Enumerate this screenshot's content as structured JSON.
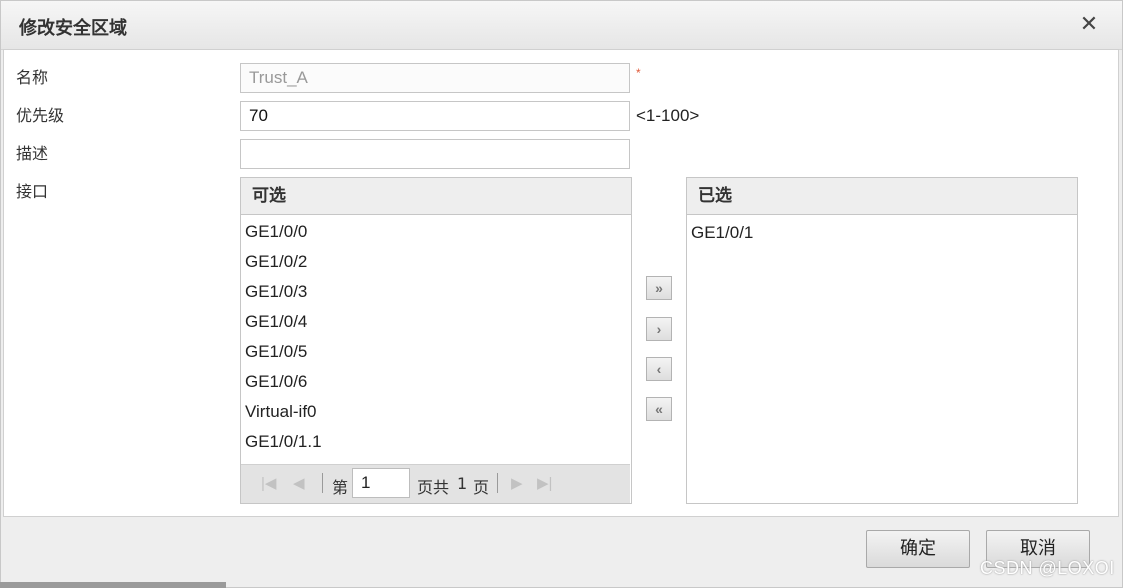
{
  "dialog": {
    "title": "修改安全区域",
    "close_glyph": "✕"
  },
  "form": {
    "name_label": "名称",
    "name_value": "Trust_A",
    "required_mark": "*",
    "priority_label": "优先级",
    "priority_value": "70",
    "priority_hint": "<1-100>",
    "desc_label": "描述",
    "desc_value": "",
    "interface_label": "接口"
  },
  "available": {
    "header": "可选",
    "items": [
      "GE1/0/0",
      "GE1/0/2",
      "GE1/0/3",
      "GE1/0/4",
      "GE1/0/5",
      "GE1/0/6",
      "Virtual-if0",
      "GE1/0/1.1"
    ]
  },
  "pager": {
    "page_prefix": "第",
    "page_value": "1",
    "page_of": "页共",
    "page_total": "1",
    "page_suffix": "页",
    "first_glyph": "|◀",
    "prev_glyph": "◀",
    "next_glyph": "▶",
    "last_glyph": "▶|"
  },
  "movers": {
    "add_all": "»",
    "add": "›",
    "remove": "‹",
    "remove_all": "«"
  },
  "selected": {
    "header": "已选",
    "items": [
      "GE1/0/1"
    ]
  },
  "footer": {
    "ok_label": "确定",
    "cancel_label": "取消"
  },
  "watermark": "CSDN @LOXOI"
}
